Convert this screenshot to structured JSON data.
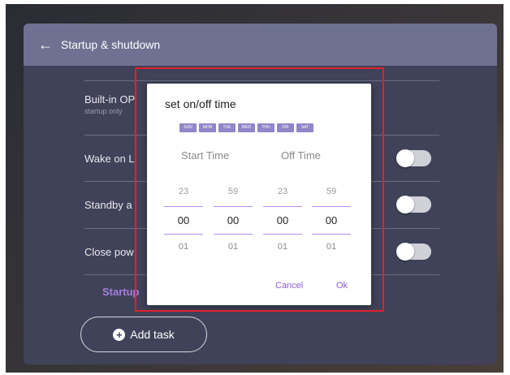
{
  "header": {
    "title": "Startup & shutdown"
  },
  "rows": [
    {
      "label": "Built-in OP",
      "sub": "startup only",
      "toggle": false
    },
    {
      "label": "Wake on L",
      "toggle": false
    },
    {
      "label": "Standby a",
      "toggle": false
    },
    {
      "label": "Close pow",
      "toggle": false
    }
  ],
  "startup_label": "Startup",
  "add_task": {
    "label": "Add task",
    "icon": "plus-circle-icon"
  },
  "dialog": {
    "title": "set on/off time",
    "days": [
      "SUN",
      "MON",
      "TUE",
      "WED",
      "THU",
      "FRI",
      "SAT"
    ],
    "start_heading": "Start Time",
    "off_heading": "Off Time",
    "pickers": [
      {
        "above": "23",
        "value": "00",
        "below": "01"
      },
      {
        "above": "59",
        "value": "00",
        "below": "01"
      },
      {
        "above": "23",
        "value": "00",
        "below": "01"
      },
      {
        "above": "59",
        "value": "00",
        "below": "01"
      }
    ],
    "cancel": "Cancel",
    "ok": "Ok"
  },
  "colors": {
    "accent": "#8a5cd9",
    "highlight_box": "#e3202a"
  }
}
